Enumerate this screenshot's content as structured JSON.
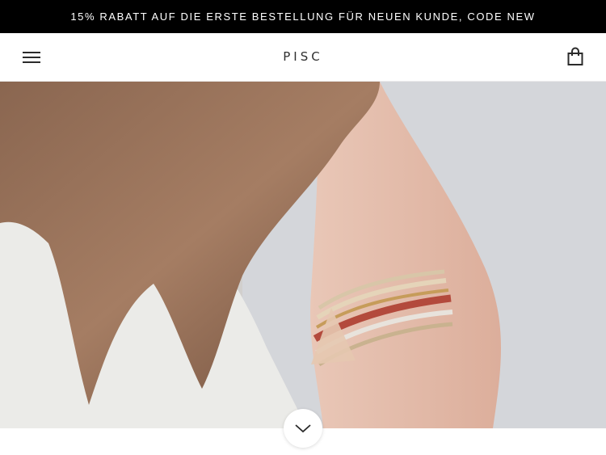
{
  "announcement": {
    "text": "15% RABATT AUF DIE ERSTE BESTELLUNG FÜR NEUEN KUNDE, CODE  NEW"
  },
  "header": {
    "logo": "PISC",
    "menu_icon": "hamburger-menu-icon",
    "cart_icon": "shopping-bag-icon"
  },
  "hero": {
    "image": "woman-with-stacked-bracelets-photo",
    "scroll_icon": "chevron-down-icon"
  },
  "colors": {
    "announcement_bg": "#000000",
    "announcement_text": "#ffffff",
    "header_bg": "#ffffff",
    "logo_text": "#2f2f2f"
  }
}
